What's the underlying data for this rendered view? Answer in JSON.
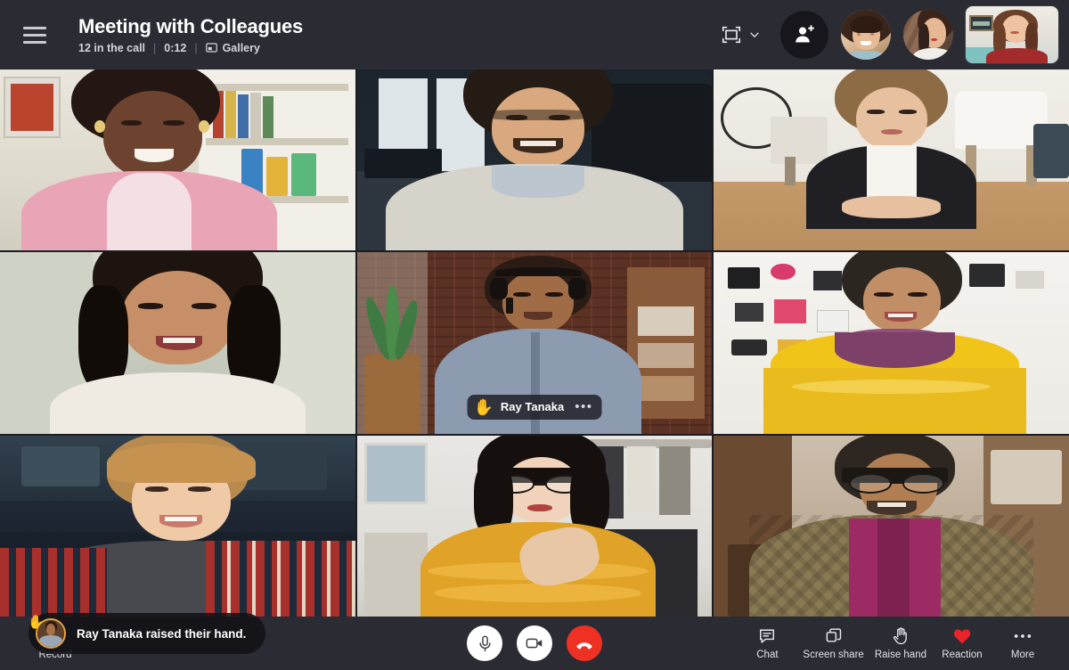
{
  "header": {
    "menu_icon": "hamburger-menu-icon",
    "title": "Meeting with Colleagues",
    "participants_text": "12 in the call",
    "separator": "|",
    "elapsed_time": "0:12",
    "layout_mode_label": "Gallery",
    "layout_mode_icon": "gallery-layout-icon",
    "fit_icon": "fit-to-frame-icon",
    "fit_chevron_icon": "chevron-down-icon",
    "add_person_icon": "add-person-icon",
    "avatars": [
      {
        "name": "avatar-participant-1"
      },
      {
        "name": "avatar-participant-2"
      }
    ],
    "selfview_name": "self-view-video"
  },
  "grid": {
    "active_index": 4,
    "tiles": [
      {
        "id": "tile-1",
        "speaker": false
      },
      {
        "id": "tile-2",
        "speaker": false
      },
      {
        "id": "tile-3",
        "speaker": false
      },
      {
        "id": "tile-4",
        "speaker": false
      },
      {
        "id": "tile-5",
        "speaker": true
      },
      {
        "id": "tile-6",
        "speaker": false
      },
      {
        "id": "tile-7",
        "speaker": false
      },
      {
        "id": "tile-8",
        "speaker": false
      },
      {
        "id": "tile-9",
        "speaker": false
      }
    ],
    "active_tile": {
      "hand_emoji": "✋",
      "name": "Ray Tanaka",
      "more_dots": "•••"
    }
  },
  "toast": {
    "hand_emoji": "✋",
    "message": "Ray Tanaka raised their hand."
  },
  "bottom_bar": {
    "record": {
      "label": "Record",
      "icon": "record-icon"
    },
    "center": [
      {
        "name": "microphone-button",
        "icon": "microphone-icon",
        "style": "light"
      },
      {
        "name": "camera-button",
        "icon": "camera-icon",
        "style": "light"
      },
      {
        "name": "hangup-button",
        "icon": "phone-hangup-icon",
        "style": "hangup"
      }
    ],
    "right": [
      {
        "label": "Chat",
        "icon": "chat-icon"
      },
      {
        "label": "Screen share",
        "icon": "screen-share-icon"
      },
      {
        "label": "Raise hand",
        "icon": "raise-hand-icon"
      },
      {
        "label": "Reaction",
        "icon": "heart-icon"
      },
      {
        "label": "More",
        "icon": "more-dots-icon"
      }
    ]
  },
  "colors": {
    "chrome_bg": "#2b2b33",
    "active_border": "#e8a33d",
    "hangup_red": "#ef3124",
    "reaction_red": "#e8232a",
    "text_primary": "#ffffff",
    "text_secondary": "#d3d3da"
  }
}
